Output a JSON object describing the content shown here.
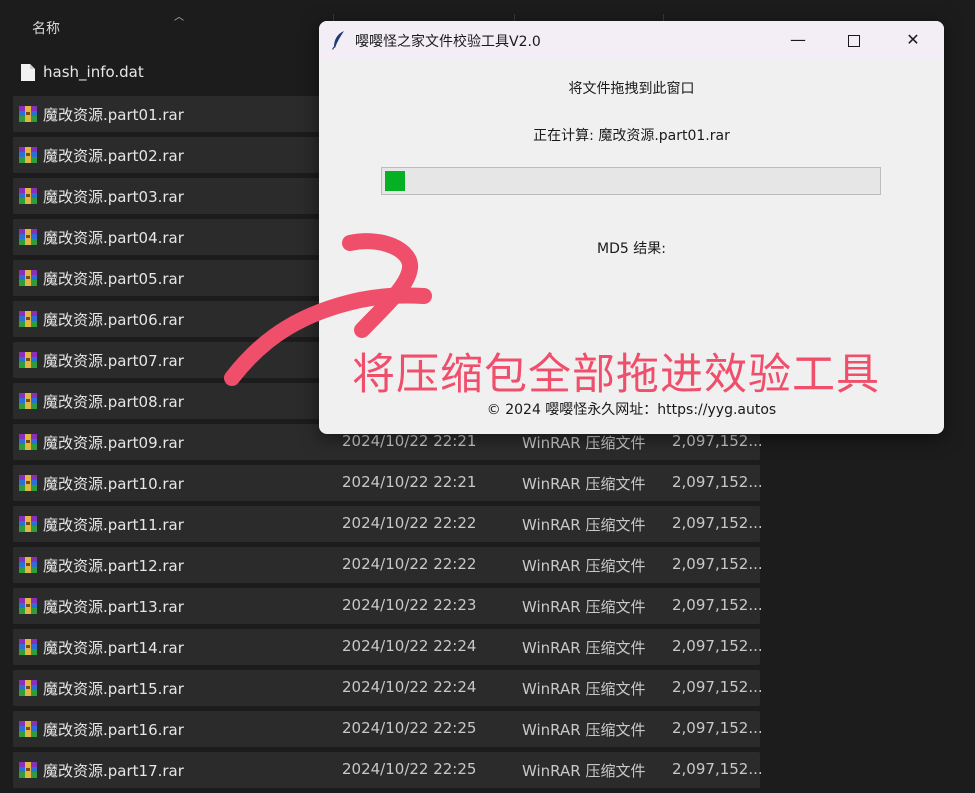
{
  "explorer": {
    "columns": {
      "name": "名称"
    },
    "plain_files": [
      {
        "name": "hash_info.dat"
      }
    ],
    "files": [
      {
        "name": "魔改资源.part01.rar",
        "date": "",
        "type": "",
        "size": ""
      },
      {
        "name": "魔改资源.part02.rar",
        "date": "",
        "type": "",
        "size": ""
      },
      {
        "name": "魔改资源.part03.rar",
        "date": "",
        "type": "",
        "size": ""
      },
      {
        "name": "魔改资源.part04.rar",
        "date": "",
        "type": "",
        "size": ""
      },
      {
        "name": "魔改资源.part05.rar",
        "date": "",
        "type": "",
        "size": ""
      },
      {
        "name": "魔改资源.part06.rar",
        "date": "",
        "type": "",
        "size": ""
      },
      {
        "name": "魔改资源.part07.rar",
        "date": "",
        "type": "",
        "size": ""
      },
      {
        "name": "魔改资源.part08.rar",
        "date": "",
        "type": "",
        "size": ""
      },
      {
        "name": "魔改资源.part09.rar",
        "date": "2024/10/22 22:21",
        "type": "WinRAR 压缩文件",
        "size": "2,097,152..."
      },
      {
        "name": "魔改资源.part10.rar",
        "date": "2024/10/22 22:21",
        "type": "WinRAR 压缩文件",
        "size": "2,097,152..."
      },
      {
        "name": "魔改资源.part11.rar",
        "date": "2024/10/22 22:22",
        "type": "WinRAR 压缩文件",
        "size": "2,097,152..."
      },
      {
        "name": "魔改资源.part12.rar",
        "date": "2024/10/22 22:22",
        "type": "WinRAR 压缩文件",
        "size": "2,097,152..."
      },
      {
        "name": "魔改资源.part13.rar",
        "date": "2024/10/22 22:23",
        "type": "WinRAR 压缩文件",
        "size": "2,097,152..."
      },
      {
        "name": "魔改资源.part14.rar",
        "date": "2024/10/22 22:24",
        "type": "WinRAR 压缩文件",
        "size": "2,097,152..."
      },
      {
        "name": "魔改资源.part15.rar",
        "date": "2024/10/22 22:24",
        "type": "WinRAR 压缩文件",
        "size": "2,097,152..."
      },
      {
        "name": "魔改资源.part16.rar",
        "date": "2024/10/22 22:25",
        "type": "WinRAR 压缩文件",
        "size": "2,097,152..."
      },
      {
        "name": "魔改资源.part17.rar",
        "date": "2024/10/22 22:25",
        "type": "WinRAR 压缩文件",
        "size": "2,097,152..."
      }
    ],
    "icons": {
      "archive": "winrar-archive-icon",
      "document": "file-icon"
    }
  },
  "dialog": {
    "title": "嘤嘤怪之家文件校验工具V2.0",
    "icon": "feather-icon",
    "drop_hint": "将文件拖拽到此窗口",
    "calc_label": "正在计算: 魔改资源.part01.rar",
    "progress_fraction": 0.04,
    "md5_label": "MD5 结果:",
    "footer": "© 2024 嘤嘤怪永久网址：https://yyg.autos",
    "buttons": {
      "minimize": "—",
      "close": "✕"
    }
  },
  "annotation": {
    "text": "将压缩包全部拖进效验工具",
    "color": "#f04f6b"
  },
  "colors": {
    "progress": "#06b025",
    "explorer_bg": "#1c1c1c",
    "row_bg": "#2b2b2b",
    "dialog_bg": "#f0f0f0"
  }
}
